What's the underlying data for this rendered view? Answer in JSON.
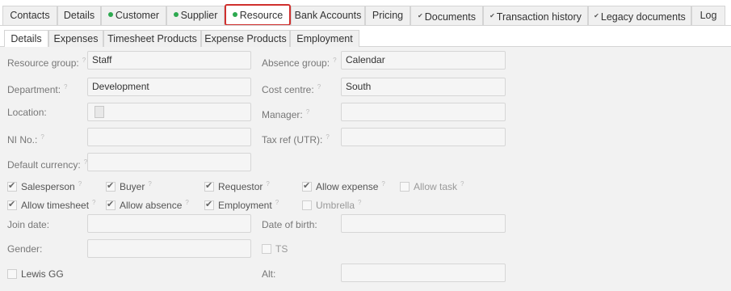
{
  "top_tabs": [
    {
      "label": "Contacts",
      "marker": ""
    },
    {
      "label": "Details",
      "marker": ""
    },
    {
      "label": "Customer",
      "marker": "dot"
    },
    {
      "label": "Supplier",
      "marker": "dot"
    },
    {
      "label": "Resource",
      "marker": "dot"
    },
    {
      "label": "Bank Accounts",
      "marker": ""
    },
    {
      "label": "Pricing",
      "marker": ""
    },
    {
      "label": "Documents",
      "marker": "tick"
    },
    {
      "label": "Transaction history",
      "marker": "tick"
    },
    {
      "label": "Legacy documents",
      "marker": "tick"
    },
    {
      "label": "Log",
      "marker": ""
    }
  ],
  "active_top_tab": "Resource",
  "sub_tabs": [
    "Details",
    "Expenses",
    "Timesheet Products",
    "Expense Products",
    "Employment"
  ],
  "active_sub_tab": "Details",
  "form": {
    "resource_group": {
      "label": "Resource group:",
      "value": "Staff"
    },
    "absence_group": {
      "label": "Absence group:",
      "value": "Calendar"
    },
    "department": {
      "label": "Department:",
      "value": "Development"
    },
    "cost_centre": {
      "label": "Cost centre:",
      "value": "South"
    },
    "location": {
      "label": "Location:",
      "value": ""
    },
    "manager": {
      "label": "Manager:",
      "value": ""
    },
    "ni_no": {
      "label": "NI No.:",
      "value": ""
    },
    "tax_ref": {
      "label": "Tax ref (UTR):",
      "value": ""
    },
    "default_currency": {
      "label": "Default currency:",
      "value": ""
    },
    "join_date": {
      "label": "Join date:",
      "value": ""
    },
    "date_of_birth": {
      "label": "Date of birth:",
      "value": ""
    },
    "gender": {
      "label": "Gender:",
      "value": ""
    },
    "alt": {
      "label": "Alt:",
      "value": ""
    },
    "help_marker": "?"
  },
  "checkboxes": {
    "salesperson": {
      "label": "Salesperson",
      "checked": true
    },
    "buyer": {
      "label": "Buyer",
      "checked": true
    },
    "requestor": {
      "label": "Requestor",
      "checked": true
    },
    "allow_expense": {
      "label": "Allow expense",
      "checked": true
    },
    "allow_task": {
      "label": "Allow task",
      "checked": false
    },
    "allow_timesheet": {
      "label": "Allow timesheet",
      "checked": true
    },
    "allow_absence": {
      "label": "Allow absence",
      "checked": true
    },
    "employment": {
      "label": "Employment",
      "checked": true
    },
    "umbrella": {
      "label": "Umbrella",
      "checked": false
    },
    "ts": {
      "label": "TS",
      "checked": false
    },
    "lewis_gg": {
      "label": "Lewis GG",
      "checked": false
    }
  }
}
